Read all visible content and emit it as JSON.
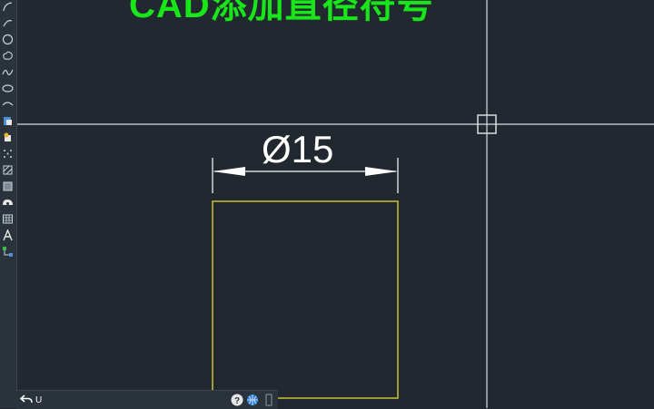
{
  "title": "CAD添加直径符号",
  "dimension": {
    "text": "Ø15"
  },
  "statusbar": {
    "undo_label": "U"
  },
  "colors": {
    "background": "#212830",
    "title": "#19e619",
    "rectangle": "#d6d130",
    "dimension": "#ffffff",
    "crosshair": "#d9dde2"
  },
  "toolbar": {
    "icons": [
      "arc-icon",
      "circle-icon",
      "cloud-icon",
      "spline-icon",
      "ellipse-icon",
      "ellipse-arc-icon",
      "insert-block-icon",
      "make-block-icon",
      "point-icon",
      "hatch-icon",
      "gradient-icon",
      "region-icon",
      "table-icon",
      "text-icon",
      "add-selected-icon"
    ]
  }
}
